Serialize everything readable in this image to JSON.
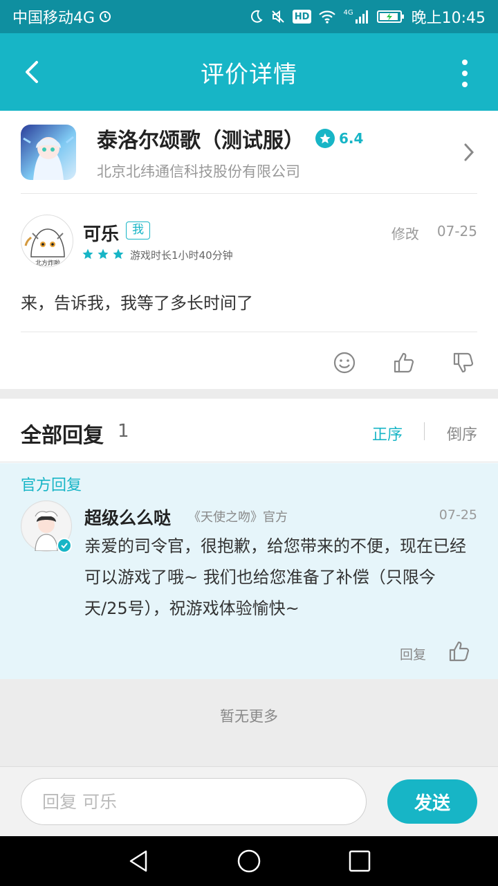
{
  "status_bar": {
    "carrier": "中国移动4G",
    "hd": "HD",
    "network": "4G",
    "time": "晚上10:45"
  },
  "header": {
    "title": "评价详情"
  },
  "game": {
    "name": "泰洛尔颂歌（测试服）",
    "score": "6.4",
    "developer": "北京北纬通信科技股份有限公司"
  },
  "review": {
    "author": "可乐",
    "me_badge": "我",
    "edit_label": "修改",
    "date": "07-25",
    "rating": 3,
    "playtime": "游戏时长1小时40分钟",
    "content": "来，告诉我，我等了多长时间了",
    "avatar_caption": "北方炸啦"
  },
  "replies": {
    "title": "全部回复",
    "count": "1",
    "sort_asc": "正序",
    "sort_desc": "倒序"
  },
  "official_reply": {
    "section_label": "官方回复",
    "author": "超级么么哒",
    "tag": "《天使之吻》官方",
    "date": "07-25",
    "content": "亲爱的司令官，很抱歉，给您带来的不便，现在已经可以游戏了哦~ 我们也给您准备了补偿（只限今天/25号），祝游戏体验愉快~",
    "reply_label": "回复"
  },
  "footer": {
    "no_more": "暂无更多"
  },
  "input_bar": {
    "placeholder": "回复 可乐",
    "send_label": "发送"
  },
  "colors": {
    "accent": "#17b5c6",
    "status_bar": "#0f8fa0",
    "official_bg": "#e6f5fa"
  }
}
